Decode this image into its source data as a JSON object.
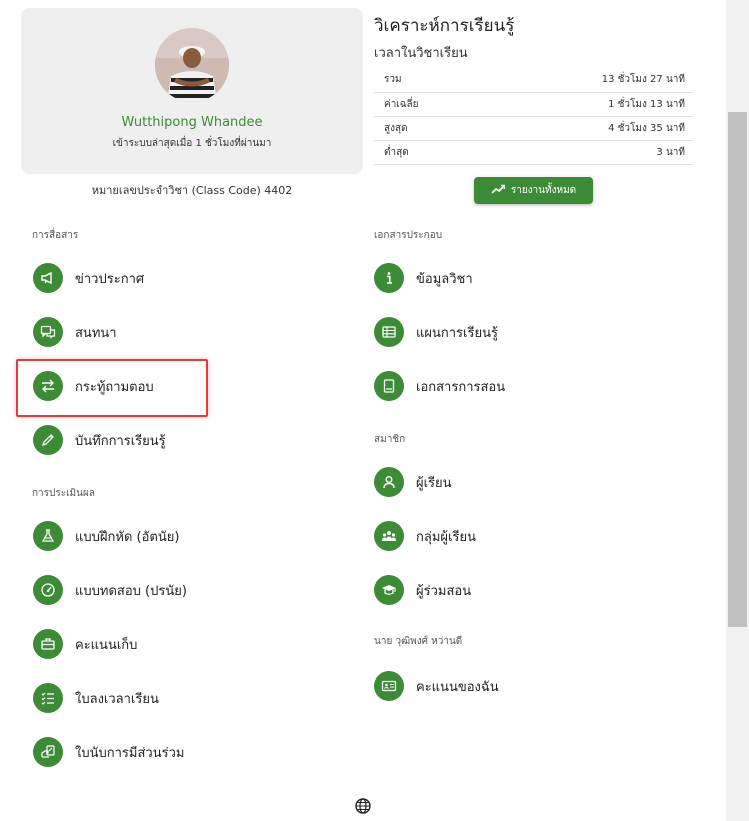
{
  "profile": {
    "name": "Wutthipong Whandee",
    "last_login": "เข้าระบบล่าสุดเมื่อ 1 ชั่วโมงที่ผ่านมา",
    "class_code": "หมายเลขประจำวิชา (Class Code) 4402"
  },
  "analytics": {
    "title": "วิเคราะห์การเรียนรู้",
    "subtitle": "เวลาในวิชาเรียน",
    "rows": [
      {
        "label": "รวม",
        "value": "13 ชั่วโมง 27 นาที"
      },
      {
        "label": "ค่าเฉลี่ย",
        "value": "1 ชั่วโมง 13 นาที"
      },
      {
        "label": "สูงสุด",
        "value": "4 ชั่วโมง 35 นาที"
      },
      {
        "label": "ต่ำสุด",
        "value": "3 นาที"
      }
    ],
    "report_button": "รายงานทั้งหมด"
  },
  "sections": {
    "communication": "การสื่อสาร",
    "assessment": "การประเมินผล",
    "documents": "เอกสารประกอบ",
    "members": "สมาชิก",
    "personal": "นาย วุฒิพงศ์ หว่านดี"
  },
  "menu": {
    "announcement": "ข่าวประกาศ",
    "chat": "สนทนา",
    "qa": "กระทู้ถามตอบ",
    "learning_log": "บันทึกการเรียนรู้",
    "exercise": "แบบฝึกหัด (อัตนัย)",
    "quiz": "แบบทดสอบ (ปรนัย)",
    "score": "คะแนนเก็บ",
    "attendance": "ใบลงเวลาเรียน",
    "participation": "ใบนับการมีส่วนร่วม",
    "course_info": "ข้อมูลวิชา",
    "learning_plan": "แผนการเรียนรู้",
    "teaching_docs": "เอกสารการสอน",
    "students": "ผู้เรียน",
    "student_groups": "กลุ่มผู้เรียน",
    "co_teachers": "ผู้ร่วมสอน",
    "my_scores": "คะแนนของฉัน"
  },
  "colors": {
    "accent": "#3d8b37",
    "highlight": "#e23b3b"
  }
}
